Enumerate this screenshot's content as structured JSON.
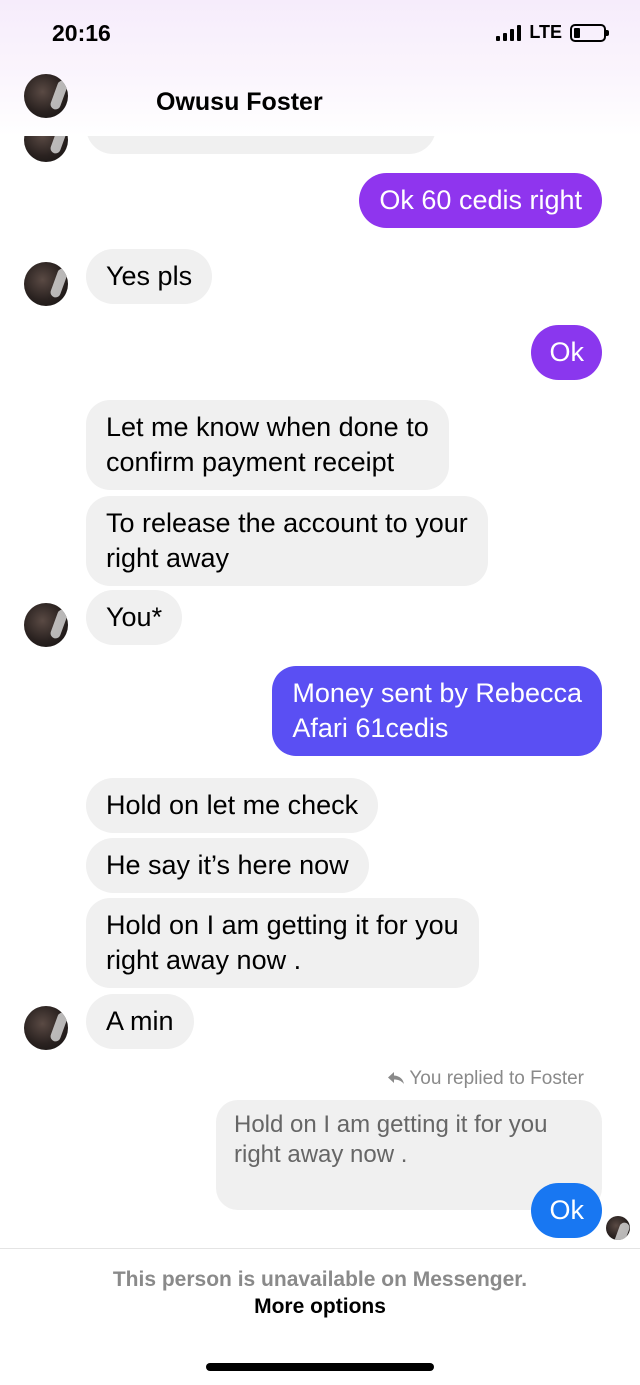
{
  "status_bar": {
    "time": "20:16",
    "network": "LTE"
  },
  "header": {
    "contact_name": "Owusu Foster"
  },
  "colors": {
    "accent": "#9b3cf0",
    "out_purple": "#8f35ee",
    "out_blue": "#5a4ff3",
    "in_bubble": "#f0f0f0"
  },
  "messages": {
    "m1": "Ok 60 cedis right",
    "m2": "Yes pls",
    "m3": "Ok",
    "m4_l1": "Let me know when done to",
    "m4_l2": "confirm payment receipt",
    "m5_l1": "To release the account to your",
    "m5_l2": "right away",
    "m6": "You*",
    "m7_l1": "Money sent by Rebecca",
    "m7_l2": "Afari  61cedis",
    "m8": "Hold on let me check",
    "m9": "He say it’s here now",
    "m10_l1": "Hold on I am getting it for you",
    "m10_l2": "right away now .",
    "m11": "A min"
  },
  "reply": {
    "note": "You replied to Foster",
    "quote_l1": "Hold on I am getting it for you",
    "quote_l2": "right away now .",
    "text": "Ok"
  },
  "footer": {
    "unavailable_text": "This person is unavailable on Messenger.",
    "more_options": "More options"
  }
}
